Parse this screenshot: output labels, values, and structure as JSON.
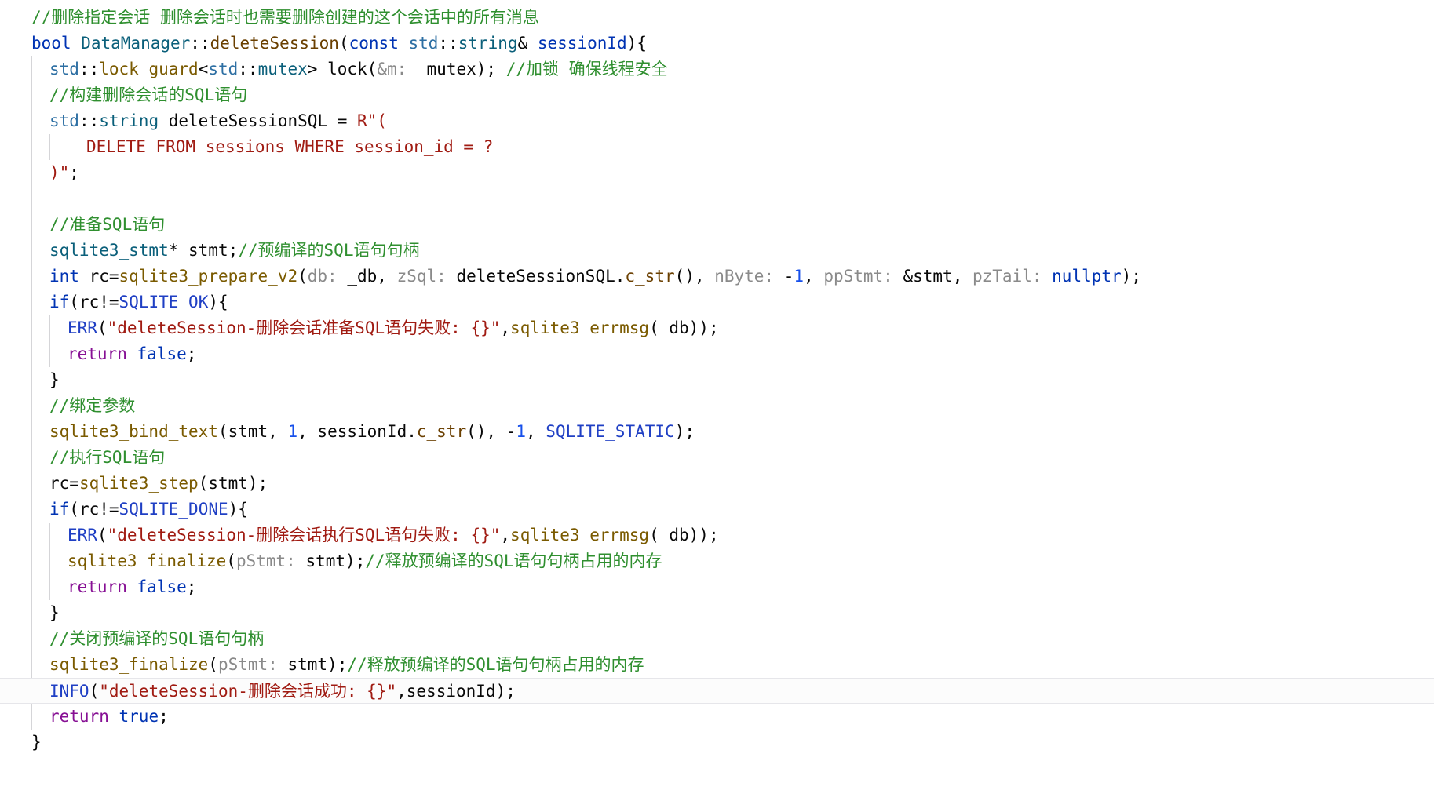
{
  "code": {
    "lines": [
      [
        {
          "t": "//删除指定会话 删除会话时也需要删除创建的这个会话中的所有消息",
          "c": "c"
        }
      ],
      [
        {
          "t": "bool ",
          "c": "k"
        },
        {
          "t": "DataManager",
          "c": "t"
        },
        {
          "t": "::",
          "c": "v"
        },
        {
          "t": "deleteSession",
          "c": "m"
        },
        {
          "t": "(",
          "c": "v"
        },
        {
          "t": "const ",
          "c": "k"
        },
        {
          "t": "std",
          "c": "ns"
        },
        {
          "t": "::",
          "c": "v"
        },
        {
          "t": "string",
          "c": "t"
        },
        {
          "t": "& ",
          "c": "v"
        },
        {
          "t": "sessionId",
          "c": "k"
        },
        {
          "t": "){",
          "c": "v"
        }
      ],
      [
        {
          "t": "std",
          "c": "ns"
        },
        {
          "t": "::",
          "c": "v"
        },
        {
          "t": "lock_guard",
          "c": "f"
        },
        {
          "t": "<",
          "c": "v"
        },
        {
          "t": "std",
          "c": "ns"
        },
        {
          "t": "::",
          "c": "v"
        },
        {
          "t": "mutex",
          "c": "t"
        },
        {
          "t": "> ",
          "c": "v"
        },
        {
          "t": "lock",
          "c": "v"
        },
        {
          "t": "(",
          "c": "v"
        },
        {
          "t": "&m: ",
          "c": "p"
        },
        {
          "t": "_mutex",
          "c": "v"
        },
        {
          "t": "); ",
          "c": "v"
        },
        {
          "t": "//加锁 确保线程安全",
          "c": "c"
        }
      ],
      [
        {
          "t": "//构建删除会话的SQL语句",
          "c": "c"
        }
      ],
      [
        {
          "t": "std",
          "c": "ns"
        },
        {
          "t": "::",
          "c": "v"
        },
        {
          "t": "string ",
          "c": "t"
        },
        {
          "t": "deleteSessionSQL",
          "c": "v"
        },
        {
          "t": " = ",
          "c": "v"
        },
        {
          "t": "R\"(",
          "c": "s"
        }
      ],
      [
        {
          "t": "DELETE FROM sessions WHERE session_id = ?",
          "c": "s"
        }
      ],
      [
        {
          "t": ")\"",
          "c": "s"
        },
        {
          "t": ";",
          "c": "v"
        }
      ],
      [],
      [
        {
          "t": "//准备SQL语句",
          "c": "c"
        }
      ],
      [
        {
          "t": "sqlite3_stmt",
          "c": "t"
        },
        {
          "t": "* ",
          "c": "v"
        },
        {
          "t": "stmt",
          "c": "v"
        },
        {
          "t": ";",
          "c": "v"
        },
        {
          "t": "//预编译的SQL语句句柄",
          "c": "c"
        }
      ],
      [
        {
          "t": "int ",
          "c": "k"
        },
        {
          "t": "rc",
          "c": "v"
        },
        {
          "t": "=",
          "c": "v"
        },
        {
          "t": "sqlite3_prepare_v2",
          "c": "f"
        },
        {
          "t": "(",
          "c": "v"
        },
        {
          "t": "db: ",
          "c": "p"
        },
        {
          "t": "_db",
          "c": "v"
        },
        {
          "t": ", ",
          "c": "v"
        },
        {
          "t": "zSql: ",
          "c": "p"
        },
        {
          "t": "deleteSessionSQL",
          "c": "v"
        },
        {
          "t": ".",
          "c": "v"
        },
        {
          "t": "c_str",
          "c": "m"
        },
        {
          "t": "()",
          "c": "v"
        },
        {
          "t": ", ",
          "c": "v"
        },
        {
          "t": "nByte: ",
          "c": "p"
        },
        {
          "t": "-",
          "c": "v"
        },
        {
          "t": "1",
          "c": "n"
        },
        {
          "t": ", ",
          "c": "v"
        },
        {
          "t": "ppStmt: ",
          "c": "p"
        },
        {
          "t": "&stmt",
          "c": "v"
        },
        {
          "t": ", ",
          "c": "v"
        },
        {
          "t": "pzTail: ",
          "c": "p"
        },
        {
          "t": "nullptr",
          "c": "k"
        },
        {
          "t": ");",
          "c": "v"
        }
      ],
      [
        {
          "t": "if",
          "c": "k"
        },
        {
          "t": "(",
          "c": "v"
        },
        {
          "t": "rc",
          "c": "v"
        },
        {
          "t": "!=",
          "c": "v"
        },
        {
          "t": "SQLITE_OK",
          "c": "mac"
        },
        {
          "t": "){",
          "c": "v"
        }
      ],
      [
        {
          "t": "ERR",
          "c": "mac"
        },
        {
          "t": "(",
          "c": "v"
        },
        {
          "t": "\"deleteSession-删除会话准备SQL语句失败: {}\"",
          "c": "s"
        },
        {
          "t": ",",
          "c": "v"
        },
        {
          "t": "sqlite3_errmsg",
          "c": "f"
        },
        {
          "t": "(",
          "c": "v"
        },
        {
          "t": "_db",
          "c": "v"
        },
        {
          "t": "));",
          "c": "v"
        }
      ],
      [
        {
          "t": "return ",
          "c": "pu"
        },
        {
          "t": "false",
          "c": "k"
        },
        {
          "t": ";",
          "c": "v"
        }
      ],
      [
        {
          "t": "}",
          "c": "v"
        }
      ],
      [
        {
          "t": "//绑定参数",
          "c": "c"
        }
      ],
      [
        {
          "t": "sqlite3_bind_text",
          "c": "f"
        },
        {
          "t": "(",
          "c": "v"
        },
        {
          "t": "stmt",
          "c": "v"
        },
        {
          "t": ", ",
          "c": "v"
        },
        {
          "t": "1",
          "c": "n"
        },
        {
          "t": ", ",
          "c": "v"
        },
        {
          "t": "sessionId",
          "c": "v"
        },
        {
          "t": ".",
          "c": "v"
        },
        {
          "t": "c_str",
          "c": "m"
        },
        {
          "t": "()",
          "c": "v"
        },
        {
          "t": ", ",
          "c": "v"
        },
        {
          "t": "-",
          "c": "v"
        },
        {
          "t": "1",
          "c": "n"
        },
        {
          "t": ", ",
          "c": "v"
        },
        {
          "t": "SQLITE_STATIC",
          "c": "mac"
        },
        {
          "t": ");",
          "c": "v"
        }
      ],
      [
        {
          "t": "//执行SQL语句",
          "c": "c"
        }
      ],
      [
        {
          "t": "rc",
          "c": "v"
        },
        {
          "t": "=",
          "c": "v"
        },
        {
          "t": "sqlite3_step",
          "c": "f"
        },
        {
          "t": "(",
          "c": "v"
        },
        {
          "t": "stmt",
          "c": "v"
        },
        {
          "t": ");",
          "c": "v"
        }
      ],
      [
        {
          "t": "if",
          "c": "k"
        },
        {
          "t": "(",
          "c": "v"
        },
        {
          "t": "rc",
          "c": "v"
        },
        {
          "t": "!=",
          "c": "v"
        },
        {
          "t": "SQLITE_DONE",
          "c": "mac"
        },
        {
          "t": "){",
          "c": "v"
        }
      ],
      [
        {
          "t": "ERR",
          "c": "mac"
        },
        {
          "t": "(",
          "c": "v"
        },
        {
          "t": "\"deleteSession-删除会话执行SQL语句失败: {}\"",
          "c": "s"
        },
        {
          "t": ",",
          "c": "v"
        },
        {
          "t": "sqlite3_errmsg",
          "c": "f"
        },
        {
          "t": "(",
          "c": "v"
        },
        {
          "t": "_db",
          "c": "v"
        },
        {
          "t": "));",
          "c": "v"
        }
      ],
      [
        {
          "t": "sqlite3_finalize",
          "c": "f"
        },
        {
          "t": "(",
          "c": "v"
        },
        {
          "t": "pStmt: ",
          "c": "p"
        },
        {
          "t": "stmt",
          "c": "v"
        },
        {
          "t": ");",
          "c": "v"
        },
        {
          "t": "//释放预编译的SQL语句句柄占用的内存",
          "c": "c"
        }
      ],
      [
        {
          "t": "return ",
          "c": "pu"
        },
        {
          "t": "false",
          "c": "k"
        },
        {
          "t": ";",
          "c": "v"
        }
      ],
      [
        {
          "t": "}",
          "c": "v"
        }
      ],
      [
        {
          "t": "//关闭预编译的SQL语句句柄",
          "c": "c"
        }
      ],
      [
        {
          "t": "sqlite3_finalize",
          "c": "f"
        },
        {
          "t": "(",
          "c": "v"
        },
        {
          "t": "pStmt: ",
          "c": "p"
        },
        {
          "t": "stmt",
          "c": "v"
        },
        {
          "t": ");",
          "c": "v"
        },
        {
          "t": "//释放预编译的SQL语句句柄占用的内存",
          "c": "c"
        }
      ],
      [
        {
          "t": "INFO",
          "c": "mac"
        },
        {
          "t": "(",
          "c": "v"
        },
        {
          "t": "\"deleteSession-删除会话成功: {}\"",
          "c": "s"
        },
        {
          "t": ",",
          "c": "v"
        },
        {
          "t": "sessionId",
          "c": "v"
        },
        {
          "t": ");",
          "c": "v"
        }
      ],
      [
        {
          "t": "return ",
          "c": "pu"
        },
        {
          "t": "true",
          "c": "k"
        },
        {
          "t": ";",
          "c": "v"
        }
      ],
      [
        {
          "t": "}",
          "c": "v"
        }
      ]
    ]
  }
}
